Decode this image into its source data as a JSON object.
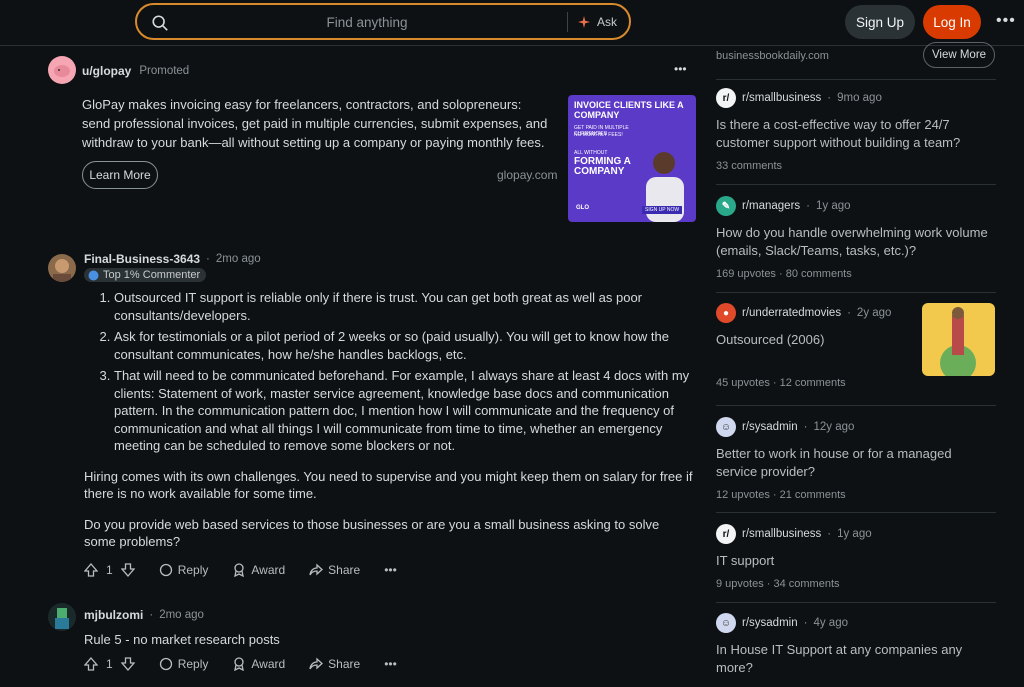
{
  "header": {
    "search_placeholder": "Find anything",
    "ask_label": "Ask",
    "signup_label": "Sign Up",
    "login_label": "Log In"
  },
  "promo": {
    "username": "u/glopay",
    "tag": "Promoted",
    "body": "GloPay makes invoicing easy for freelancers, contractors, and solopreneurs: send professional invoices, get paid in multiple currencies, submit expenses, and withdraw to your bank—all without setting up a company or paying monthly fees.",
    "cta_label": "Learn More",
    "domain": "glopay.com",
    "ad": {
      "headline": "INVOICE CLIENTS LIKE A COMPANY",
      "bullets": [
        "GET PAID IN MULTIPLE CURRENCIES",
        "NO MONTHLY FEES!"
      ],
      "small": "ALL WITHOUT",
      "big": "FORMING A COMPANY",
      "brand": "GLO",
      "btn": "SIGN UP NOW"
    }
  },
  "comments": [
    {
      "username": "Final-Business-3643",
      "time": "2mo ago",
      "badge": "Top 1% Commenter",
      "list": [
        "Outsourced IT support is reliable only if there is trust. You can get both great as well as poor consultants/developers.",
        "Ask for testimonials or a pilot period of 2 weeks or so (paid usually). You will get to know how the consultant communicates, how he/she handles backlogs, etc.",
        "That will need to be communicated beforehand. For example, I always share at least 4 docs with my clients: Statement of work, master service agreement, knowledge base docs and communication pattern. In the communication pattern doc, I mention how I will communicate and the frequency of communication and what all things I will communicate from time to time, whether an emergency meeting can be scheduled to remove some blockers or not."
      ],
      "paragraphs": [
        "Hiring comes with its own challenges. You need to supervise and you might keep them on salary for free if there is no work available for some time.",
        "Do you provide web based services to those businesses or are you a small business asking to solve some problems?"
      ],
      "votes": "1",
      "reply": "Reply",
      "award": "Award",
      "share": "Share"
    },
    {
      "username": "mjbulzomi",
      "time": "2mo ago",
      "text": "Rule 5 - no market research posts",
      "votes": "1",
      "reply": "Reply",
      "award": "Award",
      "share": "Share"
    }
  ],
  "sidebar": {
    "top_domain": "businessbookdaily.com",
    "view_more": "View More",
    "items": [
      {
        "sub": "r/smallbusiness",
        "time": "9mo ago",
        "title": "Is there a cost-effective way to offer 24/7 customer support without building a team?",
        "stats": "33 comments"
      },
      {
        "sub": "r/managers",
        "time": "1y ago",
        "title": "How do you handle overwhelming work volume (emails, Slack/Teams, tasks, etc.)?",
        "stats": "169 upvotes · 80 comments"
      },
      {
        "sub": "r/underratedmovies",
        "time": "2y ago",
        "title": "Outsourced (2006)",
        "stats": "45 upvotes · 12 comments"
      },
      {
        "sub": "r/sysadmin",
        "time": "12y ago",
        "title": "Better to work in house or for a managed service provider?",
        "stats": "12 upvotes · 21 comments"
      },
      {
        "sub": "r/smallbusiness",
        "time": "1y ago",
        "title": "IT support",
        "stats": "9 upvotes · 34 comments"
      },
      {
        "sub": "r/sysadmin",
        "time": "4y ago",
        "title": "In House IT Support at any companies any more?",
        "stats": ""
      }
    ]
  },
  "colors": {
    "accent": "#d93a00",
    "search_border": "#d98a2c",
    "background": "#0e1113"
  }
}
